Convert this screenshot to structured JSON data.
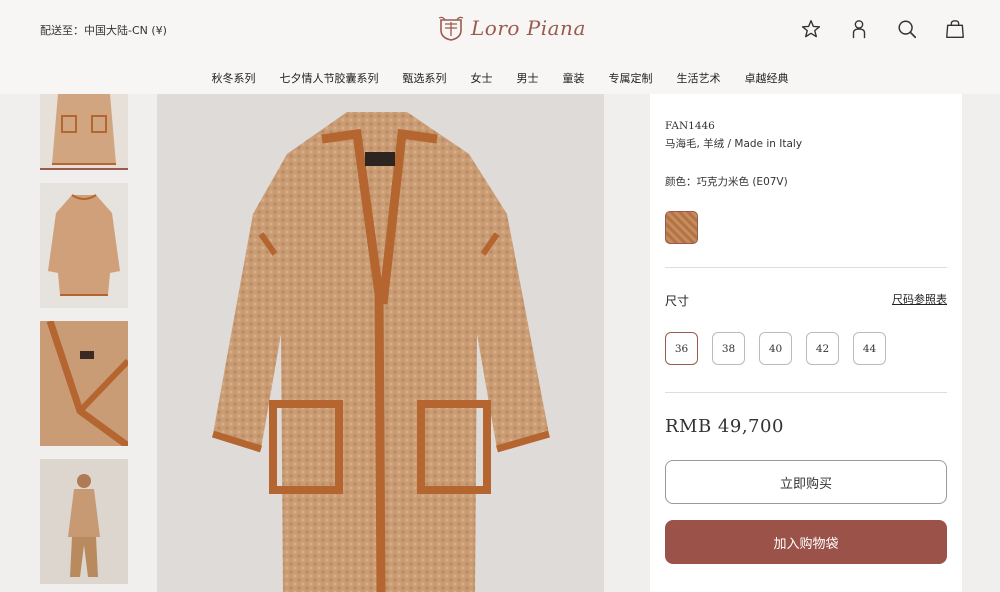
{
  "header": {
    "ship_to": "配送至：中国大陆-CN (¥)",
    "brand": "Loro Piana",
    "icons": [
      "star-icon",
      "account-icon",
      "search-icon",
      "shopping-bag-icon"
    ]
  },
  "nav": {
    "items": [
      "秋冬系列",
      "七夕情人节胶囊系列",
      "甄选系列",
      "女士",
      "男士",
      "童装",
      "专属定制",
      "生活艺术",
      "卓越经典"
    ]
  },
  "product": {
    "sku": "FAN1446",
    "material": "马海毛, 羊绒 / Made in Italy",
    "color_label": "颜色：巧克力米色 (E07V)",
    "size_title": "尺寸",
    "size_chart": "尺码参照表",
    "sizes": [
      "36",
      "38",
      "40",
      "42",
      "44"
    ],
    "selected_size": "36",
    "price": "RMB 49,700",
    "buy_now": "立即购买",
    "add_to_bag": "加入购物袋"
  },
  "colors": {
    "accent": "#9a5249",
    "brand": "#9a5b4e",
    "camel": "#c79a74",
    "leather_trim": "#b5652f"
  }
}
